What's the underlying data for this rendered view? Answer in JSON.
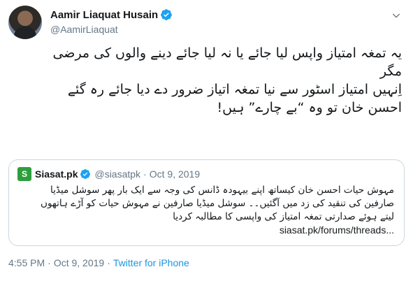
{
  "author": {
    "display_name": "Aamir Liaquat Husain",
    "handle": "@AamirLiaquat",
    "verified": true
  },
  "tweet": {
    "lines": [
      "یہ تمغہ امتیاز واپس لیا جائے یا نہ لیا جائے دینے والوں کی مرضی",
      "مگر",
      "اِنہیں امتیاز اسٹور سے نیا تمغہ اتیاز ضرور دے دیا جائے رہ گئے",
      "احسن خان تو وہ “بے چارے” ہیں!"
    ]
  },
  "quote": {
    "logo_text": "S",
    "display_name": "Siasat.pk",
    "handle": "@siasatpk",
    "separator": "·",
    "date": "Oct 9, 2019",
    "lines": [
      "مہوش حیات  احسن خان کیساتھ اپنے بیہودہ ڈانس کی وجہ سے ایک بار پھر سوشل میڈیا",
      "صارفین کی تنقید کی زد میں آگئیں۔۔ سوشل میڈیا صارفین نے مہوش حیات کو آڑے ہاتھوں",
      "لیتے ہوئے صدارتی تمغہ امتیاز کی واپسی کا مطالبہ کردیا"
    ],
    "link": "siasat.pk/forums/threads..."
  },
  "meta": {
    "time": "4:55 PM",
    "separator": "·",
    "date": "Oct 9, 2019",
    "separator2": "·",
    "source": "Twitter for iPhone"
  },
  "colors": {
    "verified_blue": "#1da1f2",
    "secondary_text": "#657786",
    "link_blue": "#1b95e0",
    "border": "#ccd6dd"
  }
}
